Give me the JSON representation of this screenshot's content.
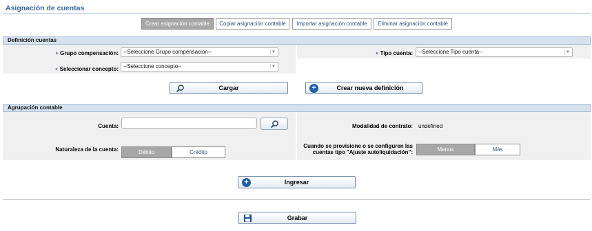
{
  "page": {
    "title": "Asignación de cuentas"
  },
  "tabs": [
    {
      "label": "Crear asignación contable",
      "active": true
    },
    {
      "label": "Copiar asignación contable",
      "active": false
    },
    {
      "label": "Importar asignación contable",
      "active": false
    },
    {
      "label": "Eliminar asignación contable",
      "active": false
    }
  ],
  "definicion": {
    "header": "Definición cuentas",
    "grupo_label": "Grupo compensación:",
    "grupo_value": "--Seleccione Grupo compensacion--",
    "concepto_label": "Seleccionar concepto:",
    "concepto_value": "--Seleccione concepto--",
    "tipo_label": "Tipo cuenta:",
    "tipo_value": "--Seleccione Tipo cuenta--",
    "cargar_label": "Cargar",
    "crear_label": "Crear nueva definición"
  },
  "agrupacion": {
    "header": "Agrupación contable",
    "cuenta_label": "Cuenta:",
    "cuenta_value": "",
    "modalidad_label": "Modalidad de contrato:",
    "modalidad_value": "undefined",
    "naturaleza_label": "Naturaleza de la cuenta:",
    "naturaleza_options": [
      {
        "label": "Débito",
        "selected": true
      },
      {
        "label": "Crédito",
        "selected": false
      }
    ],
    "provisione_label_1": "Cuando se provisione o se configuren las",
    "provisione_label_2": "cuentas tipo \"Ajuste autoliquidación\":",
    "provisione_options": [
      {
        "label": "Menos",
        "selected": true
      },
      {
        "label": "Más",
        "selected": false
      }
    ],
    "ingresar_label": "Ingresar"
  },
  "footer": {
    "grabar_label": "Grabar"
  },
  "colors": {
    "accent": "#1f5fa6",
    "title": "#3a6a9e",
    "header_bg": "#d5e1ee",
    "selected": "#a7a7a7"
  },
  "icons": {
    "search": "search-icon",
    "add": "plus-circle-icon",
    "save": "floppy-disk-icon"
  }
}
